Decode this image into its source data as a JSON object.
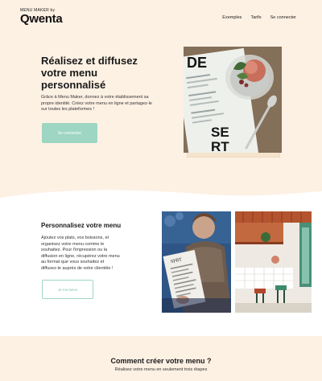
{
  "brand": {
    "small": "MENU MAKER by",
    "name": "Qwenta"
  },
  "nav": {
    "items": [
      "Exemples",
      "Tarifs",
      "Se connecter"
    ]
  },
  "hero": {
    "title": "Réalisez et diffusez votre menu personnalisé",
    "text": "Grâce à Menu Maker, donnez à votre établissement sa propre identité. Créez votre menu en ligne et partagez-le sur toutes les plateformes !",
    "button": "Se connecter",
    "menu_card_letters": [
      "DE",
      "SE",
      "RT"
    ]
  },
  "section2": {
    "title": "Personnalisez votre menu",
    "text": "Ajoutez vos plats, vos boissons, et organisez votre menu comme le souhaitez. Pour l'impression ou la diffusion en ligne, récupérez votre menu au format que vous souhaitez et diffusez-le auprès de votre clientèle !",
    "button": "Je me lance"
  },
  "section3": {
    "title": "Comment créer votre menu ?",
    "subtitle": "Réalisez votre menu en seulement trois étapes"
  },
  "colors": {
    "background": "#fdf1e4",
    "accent": "#9dd6c3",
    "white": "#ffffff"
  }
}
